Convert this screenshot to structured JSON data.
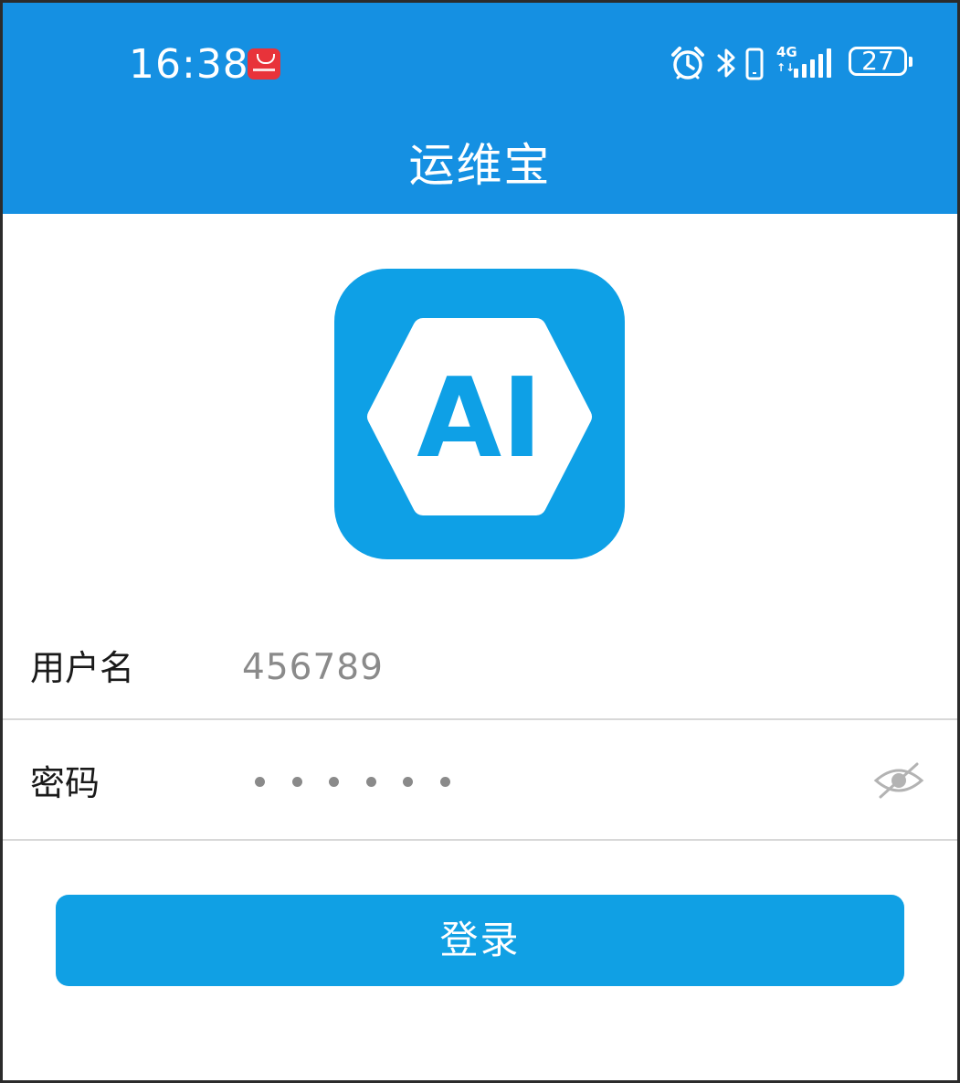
{
  "status_bar": {
    "time": "16:38",
    "network": "4G",
    "network_arrows": "↑↓",
    "battery": "27",
    "icons": [
      "huawei-notification-icon",
      "alarm-icon",
      "bluetooth-icon",
      "vibrate-icon",
      "signal-icon",
      "battery-icon"
    ]
  },
  "header": {
    "title": "运维宝"
  },
  "logo": {
    "text": "AI",
    "background_color": "#0ea0e6"
  },
  "form": {
    "username_label": "用户名",
    "username_value": "456789",
    "password_label": "密码",
    "password_length": 6,
    "show_password_icon": "eye-off-icon"
  },
  "actions": {
    "login_label": "登录"
  },
  "colors": {
    "primary": "#1590e2",
    "button": "#10a0e4",
    "divider": "#d8d8d8",
    "text": "#1a1a1a",
    "muted": "#8a8a8a"
  }
}
